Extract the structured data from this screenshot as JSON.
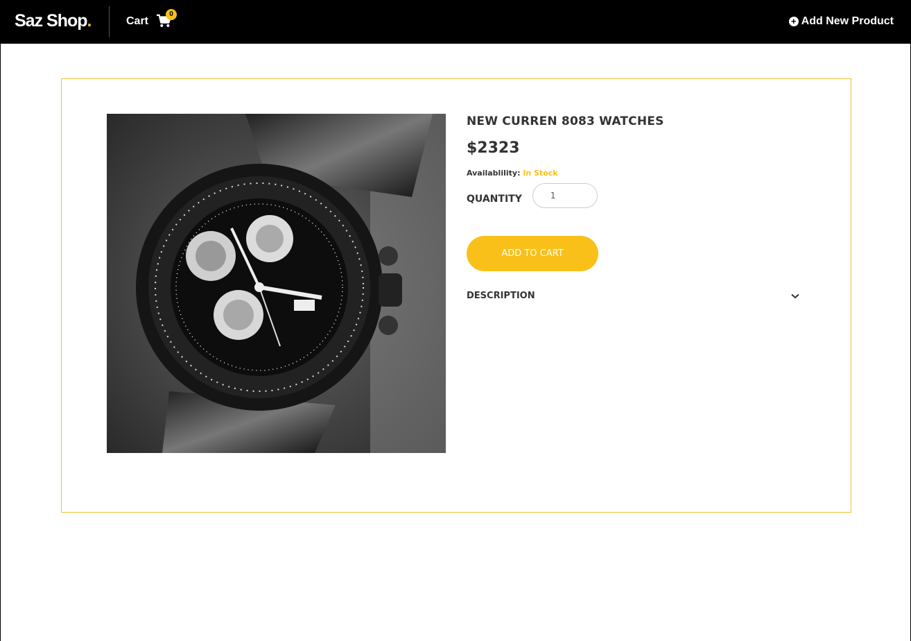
{
  "navbar": {
    "brand": "Saz Shop",
    "brand_dot": ".",
    "cart_label": "Cart",
    "cart_count": "0",
    "cart_icon": "shopping-cart-icon",
    "add_product_label": "Add New Product",
    "add_icon": "plus-circle-icon"
  },
  "product": {
    "title": "NEW CURREN 8083 WATCHES",
    "price": "$2323",
    "availability_label": "Availablility:",
    "availability_value": "In Stock",
    "quantity_label": "QUANTITY",
    "quantity_value": "1",
    "add_to_cart_label": "ADD TO CART",
    "description_label": "DESCRIPTION",
    "image_subject": "black chronograph wristwatch"
  },
  "colors": {
    "accent": "#f9c01a",
    "navbar_bg": "#000000",
    "text": "#333333"
  }
}
